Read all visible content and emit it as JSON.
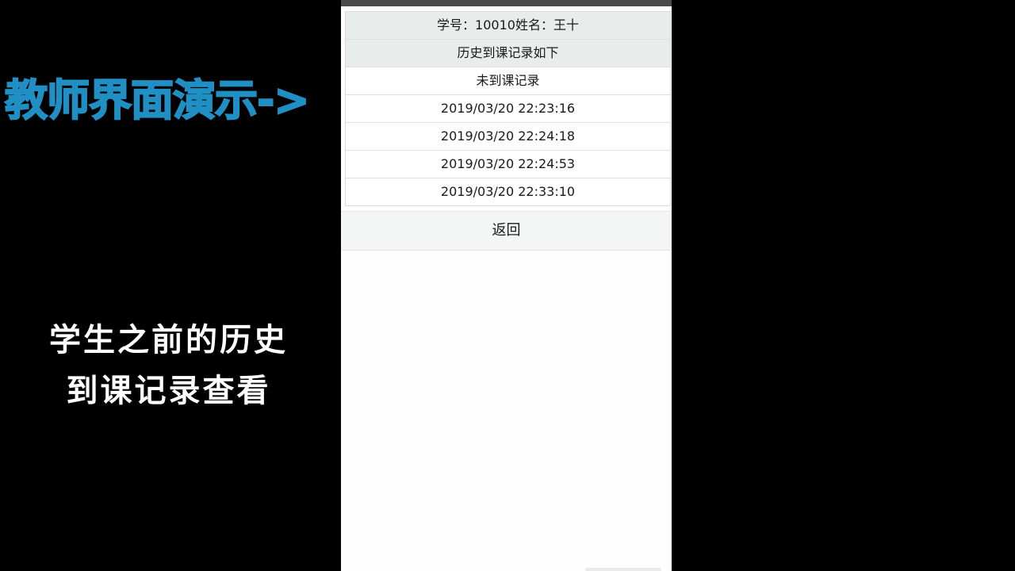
{
  "overlay": {
    "title": "教师界面演示->",
    "caption_line1": "学生之前的历史",
    "caption_line2": "到课记录查看"
  },
  "record_table": {
    "student_info": "学号：10010姓名：王十",
    "history_heading": "历史到课记录如下",
    "absence_heading": "未到课记录",
    "records": [
      "2019/03/20 22:23:16",
      "2019/03/20 22:24:18",
      "2019/03/20 22:24:53",
      "2019/03/20 22:33:10"
    ]
  },
  "actions": {
    "back_label": "返回"
  },
  "colors": {
    "title_accent": "#1f8fc4",
    "header_row_bg": "#e8edec",
    "background": "#000000"
  }
}
